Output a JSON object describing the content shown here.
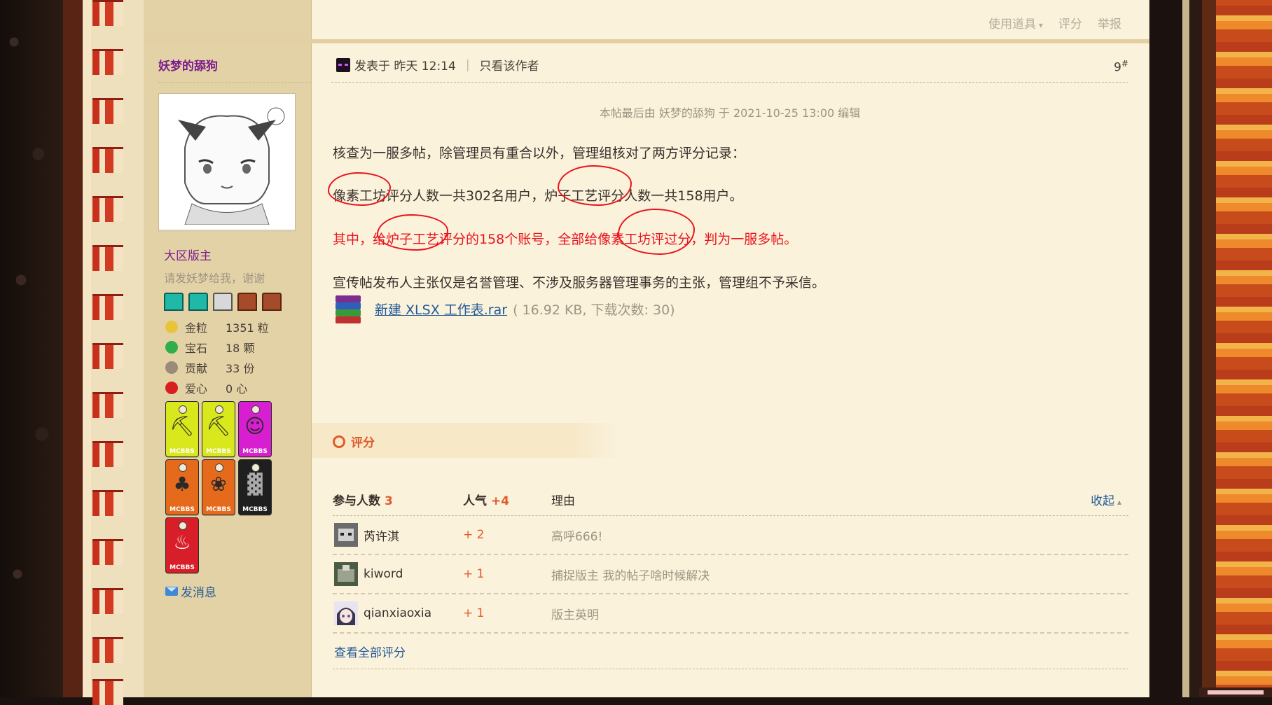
{
  "top_actions": {
    "tools": "使用道具",
    "rate": "评分",
    "report": "举报"
  },
  "author": {
    "name": "妖梦的舔狗",
    "rank": "大区版主",
    "motto": "请发妖梦给我，谢谢",
    "stats": [
      {
        "icon": "gold-nugget-icon",
        "label": "金粒",
        "value": "1351 粒",
        "color": "#e9c43a"
      },
      {
        "icon": "emerald-icon",
        "label": "宝石",
        "value": "18 颗",
        "color": "#2fae4b"
      },
      {
        "icon": "contribution-icon",
        "label": "贡献",
        "value": "33 份",
        "color": "#9a8a78"
      },
      {
        "icon": "apple-icon",
        "label": "爱心",
        "value": "0 心",
        "color": "#d81e1e"
      }
    ],
    "medal_tag": "MCBBS",
    "send_message": "发消息"
  },
  "post": {
    "posted_at": "发表于 昨天 12:14",
    "only_author": "只看该作者",
    "floor_num": "9",
    "floor_mark": "#",
    "edited_note": "本帖最后由 妖梦的舔狗 于 2021-10-25 13:00 编辑",
    "lines": [
      "核查为一服多帖，除管理员有重合以外，管理组核对了两方评分记录：",
      "像素工坊评分人数一共302名用户，炉子工艺评分人数一共158用户。",
      "其中，给炉子工艺评分的158个账号，全部给像素工坊评过分，判为一服多帖。",
      "宣传帖发布人主张仅是名誉管理、不涉及服务器管理事务的主张，管理组不予采信。"
    ],
    "attachment": {
      "name": "新建 XLSX 工作表.rar",
      "info": "( 16.92 KB, 下载次数: 30)"
    }
  },
  "ratings": {
    "title": "评分",
    "col_participants": "参与人数",
    "participants_count": "3",
    "col_popularity": "人气",
    "popularity_total": "+4",
    "col_reason": "理由",
    "collapse": "收起",
    "rows": [
      {
        "user": "芮许淇",
        "score": "+ 2",
        "reason": "高呼666!"
      },
      {
        "user": "kiword",
        "score": "+ 1",
        "reason": "捕捉版主 我的帖子啥时候解决"
      },
      {
        "user": "qianxiaoxia",
        "score": "+ 1",
        "reason": "版主英明"
      }
    ],
    "view_all": "查看全部评分"
  }
}
